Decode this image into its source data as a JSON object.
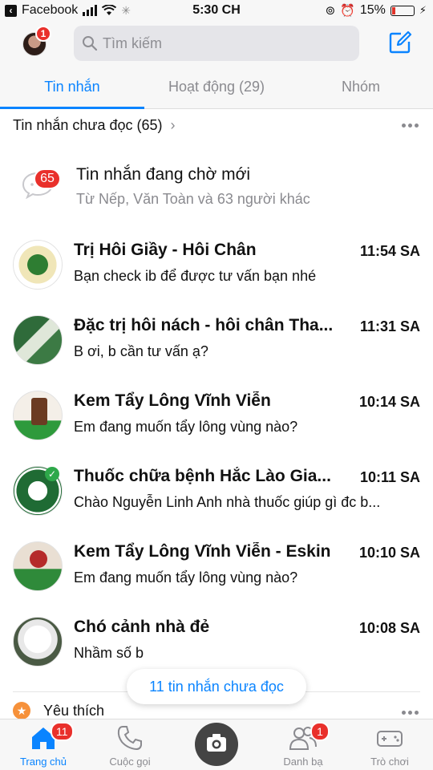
{
  "status_bar": {
    "back_app": "Facebook",
    "time": "5:30 CH",
    "battery": "15%"
  },
  "header": {
    "avatar_badge": "1",
    "search_placeholder": "Tìm kiếm"
  },
  "tabs": [
    {
      "label": "Tin nhắn",
      "active": true
    },
    {
      "label": "Hoạt động (29)",
      "active": false
    },
    {
      "label": "Nhóm",
      "active": false
    }
  ],
  "section": {
    "title": "Tin nhắn chưa đọc (65)"
  },
  "pending": {
    "badge": "65",
    "title": "Tin nhắn đang chờ mới",
    "subtitle": "Từ Nếp, Văn Toàn và 63 người khác"
  },
  "conversations": [
    {
      "name": "Trị Hôi Giầy - Hôi Chân",
      "time": "11:54 SA",
      "message": "Bạn check ib để được tư vấn bạn nhé"
    },
    {
      "name": "Đặc trị hôi nách - hôi chân Tha...",
      "time": "11:31 SA",
      "message": "B ơi, b cần tư vấn ạ?"
    },
    {
      "name": "Kem Tẩy Lông Vĩnh Viễn",
      "time": "10:14 SA",
      "message": "Em đang muốn tẩy lông vùng nào?"
    },
    {
      "name": "Thuốc chữa bệnh Hắc Lào Gia...",
      "time": "10:11 SA",
      "message": "Chào Nguyễn Linh Anh nhà thuốc giúp gì đc b..."
    },
    {
      "name": "Kem Tẩy Lông Vĩnh Viễn - Eskin",
      "time": "10:10 SA",
      "message": "Em đang muốn tẩy lông vùng nào?"
    },
    {
      "name": "Chó cảnh nhà đẻ",
      "time": "10:08 SA",
      "message": "Nhầm số b"
    }
  ],
  "unread_pill": "11 tin nhắn chưa đọc",
  "favorites": {
    "title": "Yêu thích"
  },
  "bottom_nav": [
    {
      "label": "Trang chủ",
      "badge": "11",
      "active": true,
      "icon": "home-icon"
    },
    {
      "label": "Cuộc gọi",
      "badge": "",
      "active": false,
      "icon": "phone-icon"
    },
    {
      "label": "",
      "badge": "",
      "active": false,
      "icon": "camera-icon"
    },
    {
      "label": "Danh bạ",
      "badge": "1",
      "active": false,
      "icon": "people-icon"
    },
    {
      "label": "Trò chơi",
      "badge": "",
      "active": false,
      "icon": "gamepad-icon"
    }
  ],
  "colors": {
    "accent": "#0a84ff",
    "badge": "#e9302b",
    "secondary_text": "#8a8a8f"
  }
}
